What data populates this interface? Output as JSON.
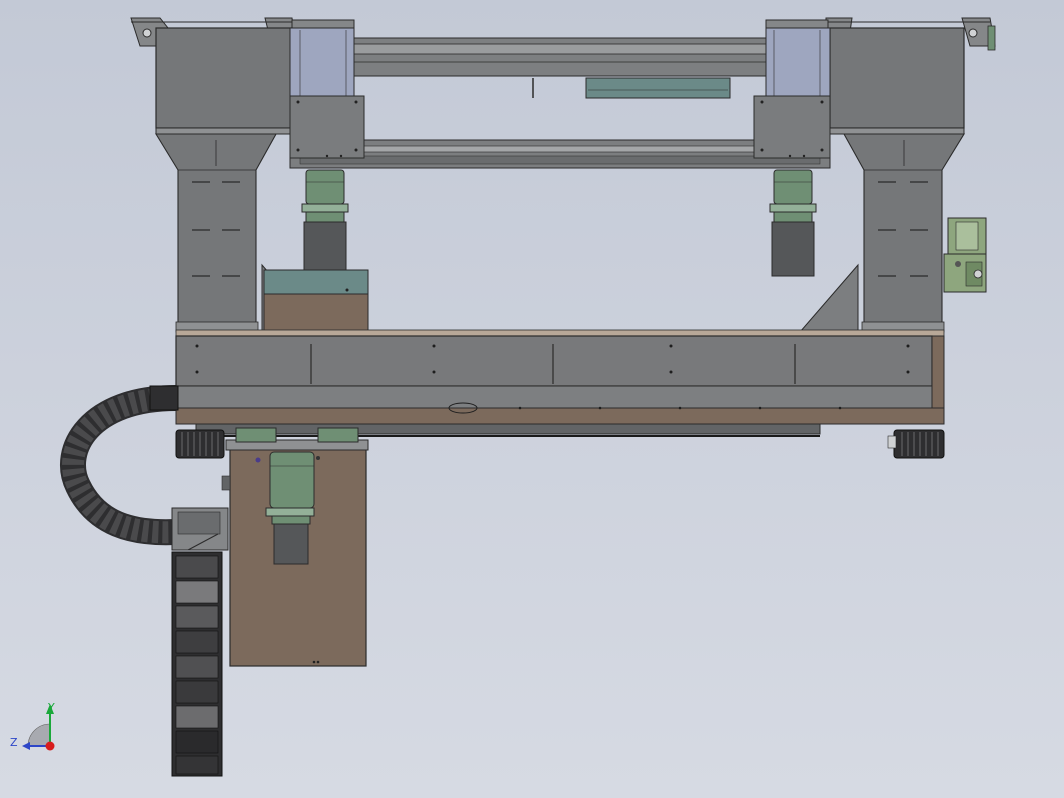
{
  "viewport": {
    "background_top": "#c3c9d6",
    "background_bottom": "#d6dae3"
  },
  "colors": {
    "frame_gray": "#757779",
    "frame_dark": "#5f6163",
    "frame_light": "#8f9193",
    "outline": "#2b2b2b",
    "brown_plate": "#7c6a5c",
    "green_motor": "#6f8f74",
    "green_motor_light": "#93b098",
    "motor_body": "#555759",
    "lavender_panel": "#9ea6bf",
    "teal_block": "#6b8a88",
    "cable_chain": "#2e2e30",
    "cable_chain_light": "#4a4a4c",
    "accent_green_unit": "#8ea67e"
  },
  "triad": {
    "y_label": "Y",
    "z_label": "Z",
    "y_color": "#1aa83a",
    "x_color": "#d81d1d",
    "z_color": "#2d46c8"
  }
}
